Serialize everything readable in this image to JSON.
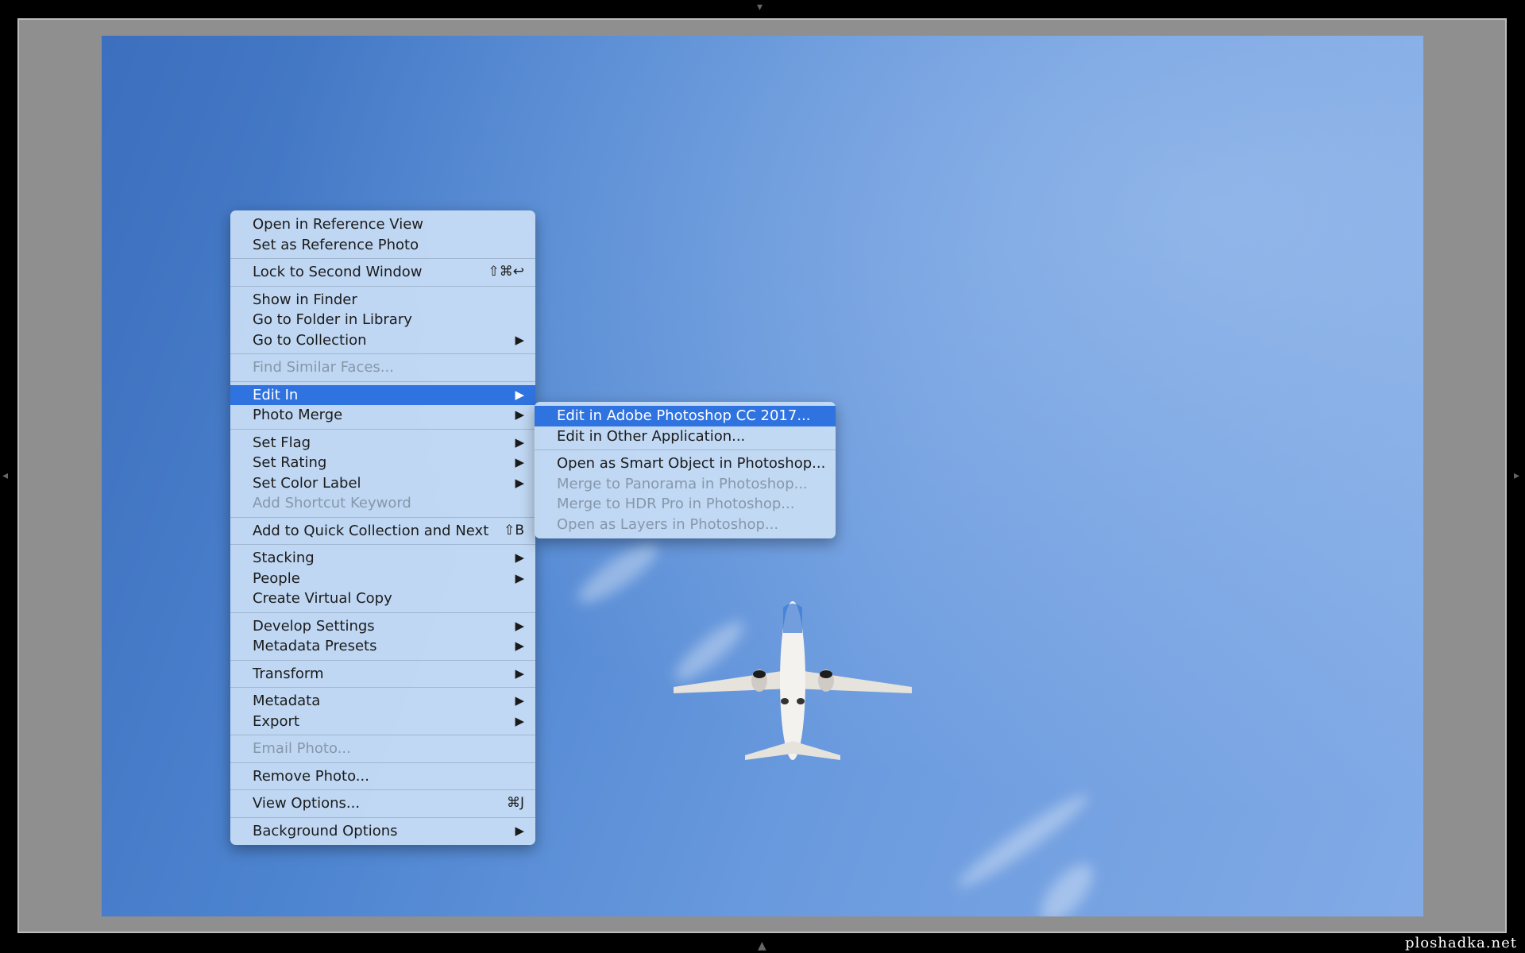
{
  "context_menu": {
    "groups": [
      [
        {
          "label": "Open in Reference View"
        },
        {
          "label": "Set as Reference Photo"
        }
      ],
      [
        {
          "label": "Lock to Second Window",
          "shortcut": "⇧⌘↩"
        }
      ],
      [
        {
          "label": "Show in Finder"
        },
        {
          "label": "Go to Folder in Library"
        },
        {
          "label": "Go to Collection",
          "submenu": true
        }
      ],
      [
        {
          "label": "Find Similar Faces...",
          "disabled": true
        }
      ],
      [
        {
          "label": "Edit In",
          "submenu": true,
          "selected": true
        },
        {
          "label": "Photo Merge",
          "submenu": true
        }
      ],
      [
        {
          "label": "Set Flag",
          "submenu": true
        },
        {
          "label": "Set Rating",
          "submenu": true
        },
        {
          "label": "Set Color Label",
          "submenu": true
        },
        {
          "label": "Add Shortcut Keyword",
          "disabled": true
        }
      ],
      [
        {
          "label": "Add to Quick Collection and Next",
          "shortcut": "⇧B"
        }
      ],
      [
        {
          "label": "Stacking",
          "submenu": true
        },
        {
          "label": "People",
          "submenu": true
        },
        {
          "label": "Create Virtual Copy"
        }
      ],
      [
        {
          "label": "Develop Settings",
          "submenu": true
        },
        {
          "label": "Metadata Presets",
          "submenu": true
        }
      ],
      [
        {
          "label": "Transform",
          "submenu": true
        }
      ],
      [
        {
          "label": "Metadata",
          "submenu": true
        },
        {
          "label": "Export",
          "submenu": true
        }
      ],
      [
        {
          "label": "Email Photo...",
          "disabled": true
        }
      ],
      [
        {
          "label": "Remove Photo..."
        }
      ],
      [
        {
          "label": "View Options...",
          "shortcut": "⌘J"
        }
      ],
      [
        {
          "label": "Background Options",
          "submenu": true
        }
      ]
    ]
  },
  "edit_in_submenu": {
    "groups": [
      [
        {
          "label": "Edit in Adobe Photoshop CC 2017...",
          "selected": true
        },
        {
          "label": "Edit in Other Application..."
        }
      ],
      [
        {
          "label": "Open as Smart Object in Photoshop..."
        },
        {
          "label": "Merge to Panorama in Photoshop...",
          "disabled": true
        },
        {
          "label": "Merge to HDR Pro in Photoshop...",
          "disabled": true
        },
        {
          "label": "Open as Layers in Photoshop...",
          "disabled": true
        }
      ]
    ]
  },
  "submenu_arrow_glyph": "▶",
  "panel_arrows": {
    "top": "▾",
    "bottom": "▲",
    "left": "◂",
    "right": "▸"
  },
  "watermark": "ploshadka.net",
  "colors": {
    "menu_background": "#c8def5",
    "selection": "#2f73e0",
    "disabled_text": "#8797aa"
  }
}
